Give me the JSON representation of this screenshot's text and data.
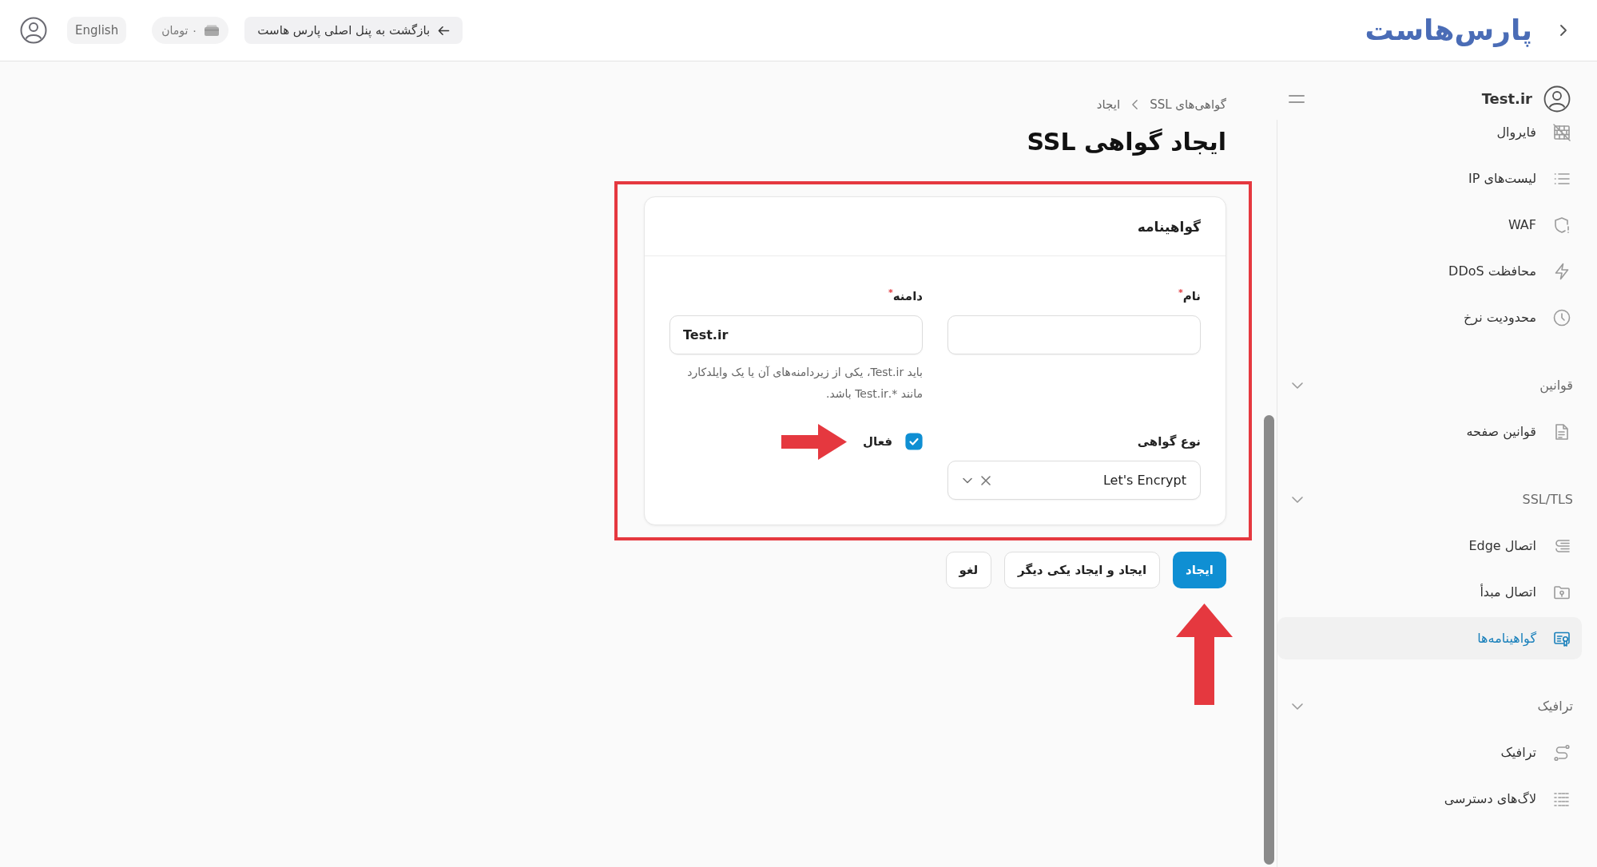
{
  "top_bar": {
    "logo": "پارس‌هاست",
    "back_button": "بازگشت به پنل اصلی پارس هاست",
    "balance": "۰ تومان",
    "language_button": "English"
  },
  "sidebar": {
    "account": "Test.ir",
    "groups": [
      {
        "items": [
          {
            "label": "فایروال",
            "selected": false
          },
          {
            "label": "لیست‌های IP",
            "selected": false
          },
          {
            "label": "WAF",
            "selected": false
          },
          {
            "label": "محافظت DDoS",
            "selected": false
          },
          {
            "label": "محدودیت نرخ",
            "selected": false
          }
        ]
      },
      {
        "title": "قوانین",
        "expanded": true,
        "items": [
          {
            "label": "قوانین صفحه",
            "selected": false
          }
        ]
      },
      {
        "title": "SSL/TLS",
        "expanded": true,
        "items": [
          {
            "label": "اتصال Edge",
            "selected": false
          },
          {
            "label": "اتصال مبدأ",
            "selected": false
          },
          {
            "label": "گواهینامه‌ها",
            "selected": true
          }
        ]
      },
      {
        "title": "ترافیک",
        "expanded": true,
        "items": [
          {
            "label": "ترافیک",
            "selected": false
          },
          {
            "label": "لاگ‌های دسترسی",
            "selected": false
          }
        ]
      }
    ]
  },
  "breadcrumbs": [
    {
      "label": "گواهی‌های SSL"
    },
    {
      "label": "ایجاد"
    }
  ],
  "title": "ایجاد گواهی SSL",
  "form": {
    "section_title": "گواهینامه",
    "fields": [
      {
        "kind": "text",
        "label": "نام$^{*}$"
      },
      {
        "kind": "text",
        "label": "دامنه$^{*}$",
        "value": "Test.ir",
        "hint": "باید Test.ir، یکی از زیردامنه‌های آن یا یک وایلدکارد مانند *.Test.ir باشد."
      },
      {
        "kind": "select",
        "label": "نوع گواهی",
        "value": "Let's Encrypt"
      },
      {
        "kind": "checkbox",
        "label": "فعال",
        "checked": true
      }
    ]
  },
  "actions": [
    {
      "label": "ایجاد",
      "kind": "primary"
    },
    {
      "label": "ایجاد و ایجاد یکی دیگر",
      "kind": "secondary"
    },
    {
      "label": "لغو",
      "kind": "secondary"
    }
  ]
}
